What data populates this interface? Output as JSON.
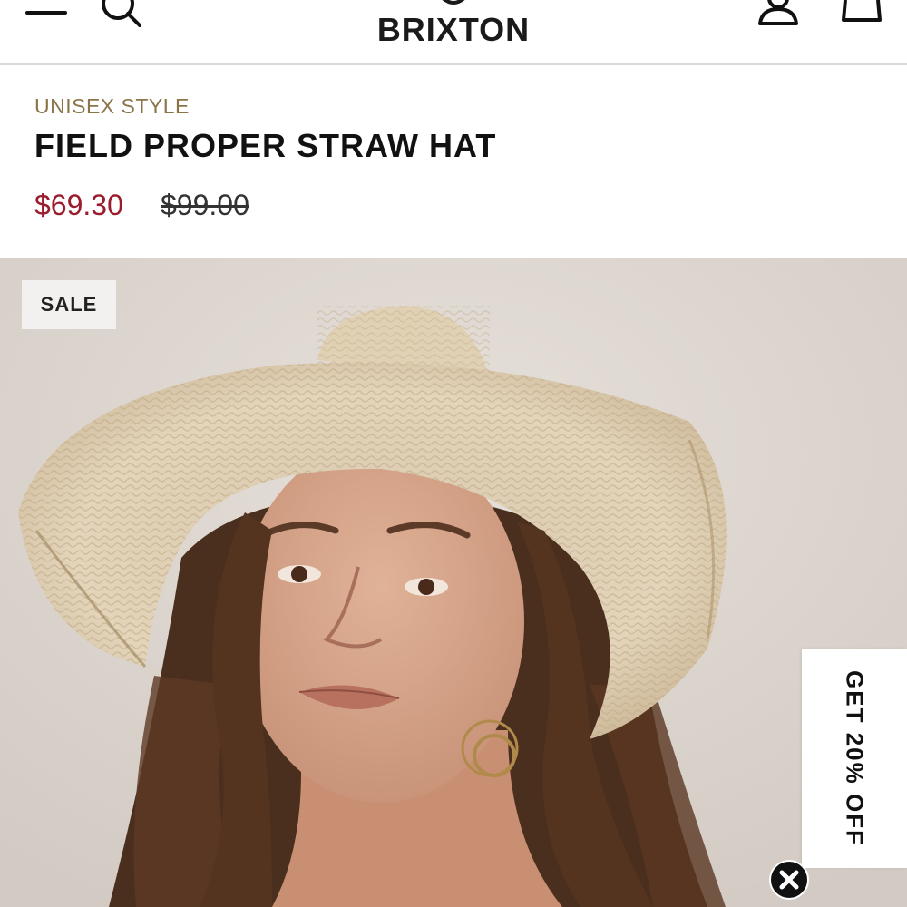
{
  "header": {
    "logo_text": "BRIXTON",
    "icons": [
      "menu-icon",
      "search-icon",
      "account-icon",
      "cart-icon"
    ]
  },
  "product": {
    "category": "UNISEX STYLE",
    "title": "FIELD PROPER STRAW HAT",
    "sale_price": "$69.30",
    "original_price": "$99.00"
  },
  "hero": {
    "badge": "SALE"
  },
  "promo": {
    "label": "GET 20% OFF"
  },
  "colors": {
    "category": "#8a7448",
    "sale_price": "#9b1c2c",
    "text": "#111111",
    "hero_background": "#ddd6d0"
  }
}
